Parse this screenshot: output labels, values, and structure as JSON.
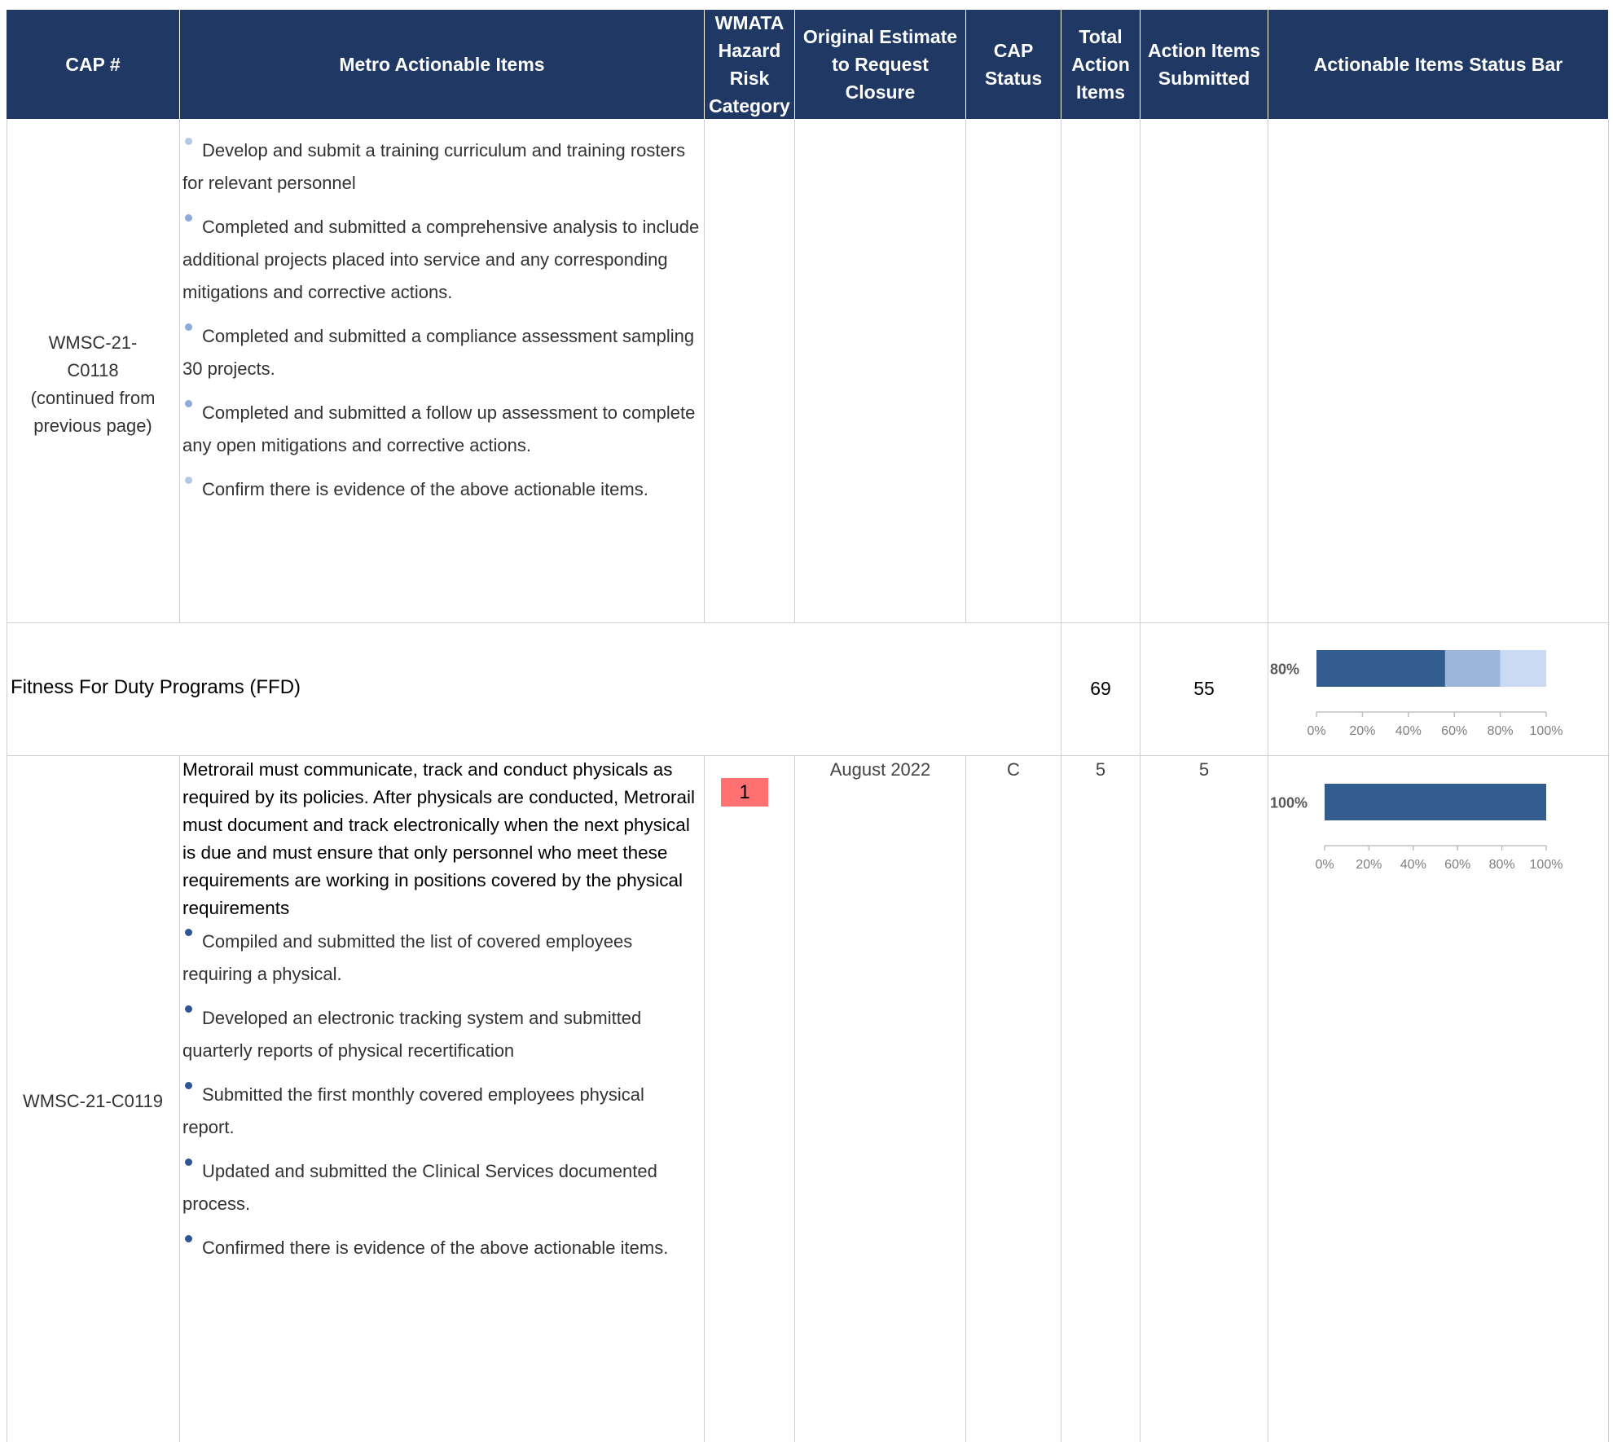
{
  "table": {
    "headers": {
      "cap_number": "CAP #",
      "actionable_items": "Metro Actionable Items",
      "hazard_category": "WMATA Hazard Risk Category",
      "estimate_closure": "Original Estimate to Request Closure",
      "cap_status": "CAP Status",
      "total_action_items": "Total Action Items",
      "items_submitted": "Action Items Submitted",
      "status_bar": "Actionable Items Status Bar"
    },
    "rows": [
      {
        "cap": "WMSC-21-C0118 (continued from previous page)",
        "items": [
          "Develop and submit a training curriculum and training rosters for relevant personnel",
          "Completed and submitted a comprehensive analysis to include additional projects placed into service and any corresponding mitigations and corrective actions.",
          "Completed and submitted a compliance assessment sampling 30 projects.",
          "Completed and submitted a follow up assessment to complete any open mitigations and corrective actions.",
          "Confirm there is evidence of the above actionable items."
        ],
        "item_status_colors": [
          "#b4c7e7",
          "#8eaadb",
          "#8eaadb",
          "#8eaadb",
          "#b4c7e7"
        ]
      },
      {
        "program": "Fitness For Duty Programs (FFD)",
        "total": "69",
        "submitted": "55"
      },
      {
        "cap": "WMSC-21-C0119",
        "lead": "Metrorail must communicate, track and conduct physicals as required by its policies. After physicals are conducted, Metrorail must document and track electronically when the next physical is due and must ensure that only personnel who meet these requirements are working in positions covered by the physical requirements",
        "items": [
          "Compiled and submitted the list of covered employees requiring a physical.",
          "Developed an electronic tracking system and submitted quarterly reports of physical recertification",
          "Submitted the first monthly covered employees physical report.",
          "Updated and submitted the Clinical Services documented process.",
          "Confirmed there is evidence of the above actionable items."
        ],
        "item_status_colors": [
          "#2f5597",
          "#2f5597",
          "#2f5597",
          "#2f5597",
          "#2f5597"
        ],
        "hazard_category": "1",
        "estimate": "August 2022",
        "status": "C",
        "total": "5",
        "submitted": "5"
      }
    ]
  },
  "chart_data": [
    {
      "type": "bar",
      "orientation": "horizontal-stacked",
      "label": "80%",
      "segments": [
        0.56,
        0.24,
        0.2
      ],
      "colors": [
        "#335c8f",
        "#9bb6d9",
        "#c9daf2"
      ],
      "ticks": [
        "0%",
        "20%",
        "40%",
        "60%",
        "80%",
        "100%"
      ],
      "xlim": [
        0,
        1
      ]
    },
    {
      "type": "bar",
      "orientation": "horizontal-stacked",
      "label": "100%",
      "segments": [
        1.0
      ],
      "colors": [
        "#335c8f"
      ],
      "ticks": [
        "0%",
        "20%",
        "40%",
        "60%",
        "80%",
        "100%"
      ],
      "xlim": [
        0,
        1
      ]
    }
  ],
  "colors": {
    "header_bg": "#1f3864",
    "hazard_badge": "#ff7070"
  }
}
